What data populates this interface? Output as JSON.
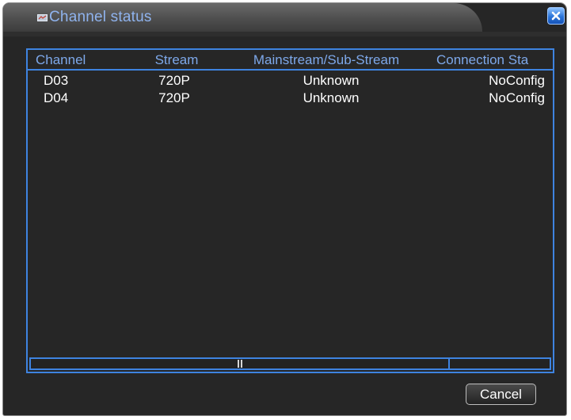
{
  "window": {
    "title": "Channel status",
    "title_icon": "channel-status-icon",
    "close_icon": "close-icon"
  },
  "table": {
    "columns": [
      "Channel",
      "Stream",
      "Mainstream/Sub-Stream",
      "Connection Sta"
    ],
    "rows": [
      [
        "D03",
        "720P",
        "Unknown",
        "NoConfig"
      ],
      [
        "D04",
        "720P",
        "Unknown",
        "NoConfig"
      ]
    ]
  },
  "footer": {
    "cancel_label": "Cancel"
  },
  "colors": {
    "background": "#262626",
    "accent": "#3e83e0",
    "title_text": "#8fb3ee",
    "header_text": "#7da8ea",
    "cell_text": "#ffffff",
    "close_button": "#2b74d8"
  }
}
